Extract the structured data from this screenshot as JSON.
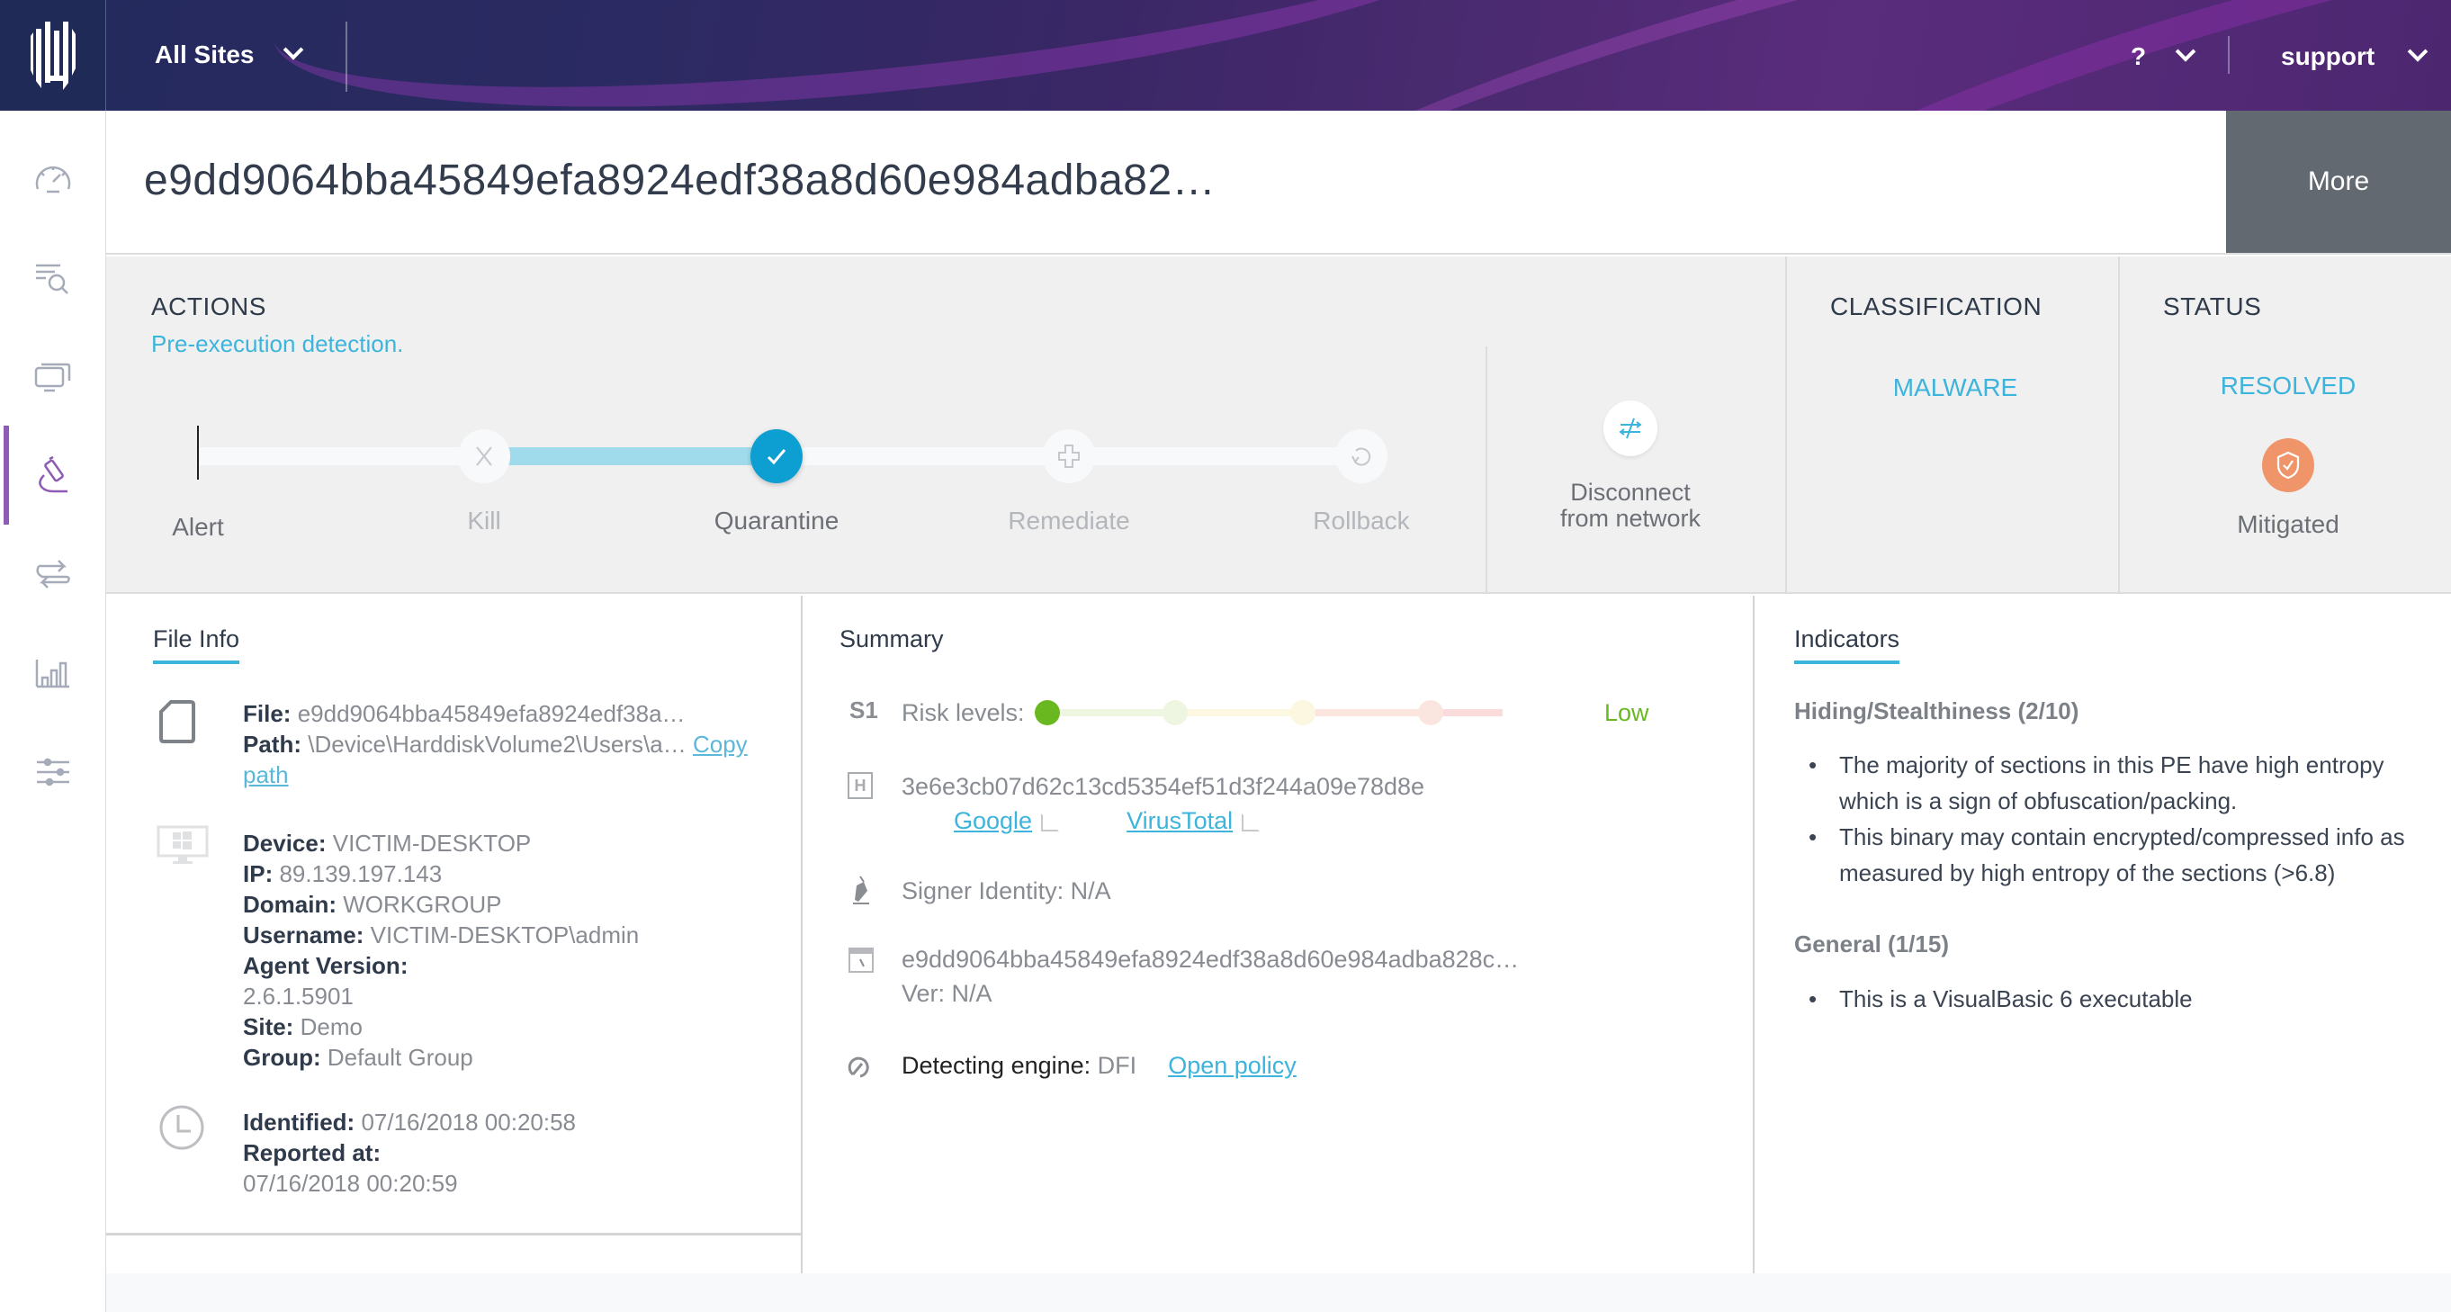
{
  "header": {
    "site_selector": "All Sites",
    "help_label": "?",
    "user_label": "support"
  },
  "sidebar": {
    "items": [
      {
        "name": "dashboard",
        "icon": "speedometer-icon",
        "active": false
      },
      {
        "name": "activity",
        "icon": "list-search-icon",
        "active": false
      },
      {
        "name": "devices",
        "icon": "monitors-icon",
        "active": false
      },
      {
        "name": "analyze",
        "icon": "microscope-icon",
        "active": true
      },
      {
        "name": "network",
        "icon": "arrows-exchange-icon",
        "active": false
      },
      {
        "name": "reports",
        "icon": "bar-chart-icon",
        "active": false
      },
      {
        "name": "settings",
        "icon": "sliders-icon",
        "active": false
      }
    ]
  },
  "title": {
    "text": "e9dd9064bba45849efa8924edf38a8d60e984adba82…",
    "more_label": "More"
  },
  "actions": {
    "heading": "ACTIONS",
    "subtitle": "Pre-execution detection.",
    "steps": [
      {
        "label": "Alert",
        "state": "origin"
      },
      {
        "label": "Kill",
        "state": "done-skipped"
      },
      {
        "label": "Quarantine",
        "state": "current"
      },
      {
        "label": "Remediate",
        "state": "pending"
      },
      {
        "label": "Rollback",
        "state": "pending"
      }
    ],
    "disconnect_label_1": "Disconnect",
    "disconnect_label_2": "from network"
  },
  "classification": {
    "heading": "CLASSIFICATION",
    "value": "MALWARE"
  },
  "status": {
    "heading": "STATUS",
    "value": "RESOLVED",
    "mitigation": "Mitigated"
  },
  "file_info": {
    "tab": "File Info",
    "file_label": "File:",
    "file_value": "e9dd9064bba45849efa8924edf38a…",
    "path_label": "Path:",
    "path_value": "\\Device\\HarddiskVolume2\\Users\\a…",
    "copy_path_1": "Copy",
    "copy_path_2": "path",
    "device_label": "Device:",
    "device_value": "VICTIM-DESKTOP",
    "ip_label": "IP:",
    "ip_value": "89.139.197.143",
    "domain_label": "Domain:",
    "domain_value": "WORKGROUP",
    "username_label": "Username:",
    "username_value": "VICTIM-DESKTOP\\admin",
    "agent_label": "Agent Version:",
    "agent_value": "2.6.1.5901",
    "site_label": "Site:",
    "site_value": "Demo",
    "group_label": "Group:",
    "group_value": "Default Group",
    "identified_label": "Identified:",
    "identified_value": "07/16/2018 00:20:58",
    "reported_label": "Reported at:",
    "reported_value": "07/16/2018 00:20:59"
  },
  "summary": {
    "tab": "Summary",
    "s1_badge": "S1",
    "risk_label": "Risk levels:",
    "risk_level_index": 0,
    "risk_level_count": 5,
    "risk_value": "Low",
    "risk_colors": [
      "#6ab820",
      "#eef5e0",
      "#fbf7e0",
      "#fbe6df",
      "#fbdcdc"
    ],
    "hash_badge": "H",
    "hash": "3e6e3cb07d62c13cd5354ef51d3f244a09e78d8e",
    "google_link": "Google",
    "virustotal_link": "VirusTotal",
    "signer_label": "Signer Identity:",
    "signer_value": "N/A",
    "file_name": "e9dd9064bba45849efa8924edf38a8d60e984adba828c…",
    "ver_label": "Ver:",
    "ver_value": "N/A",
    "engine_label": "Detecting engine:",
    "engine_value": "DFI",
    "open_policy": "Open policy"
  },
  "indicators": {
    "tab": "Indicators",
    "groups": [
      {
        "title": "Hiding/Stealthiness (2/10)",
        "items": [
          "The majority of sections in this PE have high entropy which is a sign of obfuscation/packing.",
          "This binary may contain encrypted/compressed info as measured by high entropy of the sections (>6.8)"
        ]
      },
      {
        "title": "General (1/15)",
        "items": [
          "This is a VisualBasic 6 executable"
        ]
      }
    ]
  },
  "colors": {
    "accent": "#3cb4dc",
    "active_nav": "#8e5bb5",
    "quarantine": "#0d9fd2",
    "mitigated": "#f0956a",
    "risk_low": "#6ab820"
  }
}
